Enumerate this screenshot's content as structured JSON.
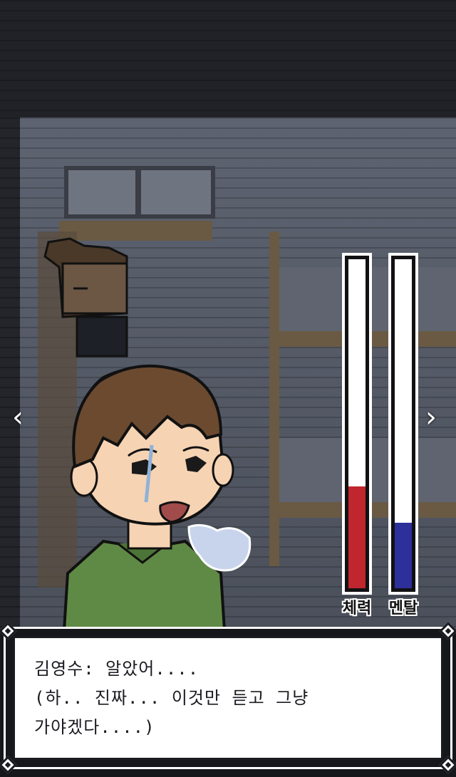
{
  "gauges": {
    "health": {
      "label": "체력",
      "level": 0.31,
      "color": "#c0262d"
    },
    "mental": {
      "label": "멘탈",
      "level": 0.2,
      "color": "#2d2f9a"
    }
  },
  "dialog": {
    "lines": [
      "김영수: 알았어....",
      "(하.. 진짜... 이것만 듣고 그냥",
      "가야겠다....)"
    ]
  },
  "nav": {
    "prev_icon": "chevron-left-icon",
    "next_icon": "chevron-right-icon"
  },
  "colors": {
    "shirt": "#5f8a45",
    "hair": "#6b4a30",
    "skin": "#f6d3b3",
    "frame": "#ffffff",
    "background": "#16171b"
  }
}
